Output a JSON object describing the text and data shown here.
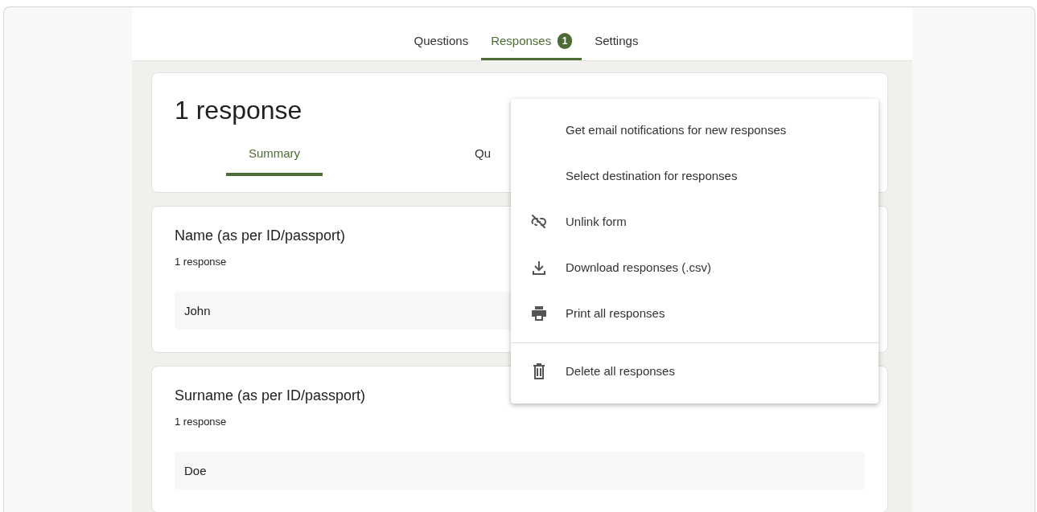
{
  "tabs": [
    {
      "label": "Questions",
      "selected": false
    },
    {
      "label": "Responses",
      "selected": true,
      "badge": "1"
    },
    {
      "label": "Settings",
      "selected": false
    }
  ],
  "summary_card": {
    "title": "1 response",
    "tabs": [
      {
        "label": "Summary",
        "selected": true
      },
      {
        "label": "Qu",
        "selected": false
      }
    ]
  },
  "questions": [
    {
      "title": "Name (as per ID/passport)",
      "count": "1 response",
      "answers": [
        "John"
      ]
    },
    {
      "title": "Surname (as per ID/passport)",
      "count": "1 response",
      "answers": [
        "Doe"
      ]
    }
  ],
  "menu": {
    "groups": [
      [
        {
          "kind": "plain",
          "label": "Get email notifications for new responses"
        },
        {
          "kind": "plain",
          "label": "Select destination for responses"
        },
        {
          "kind": "unlink",
          "label": "Unlink form"
        },
        {
          "kind": "download",
          "label": "Download responses (.csv)"
        },
        {
          "kind": "print",
          "label": "Print all responses"
        }
      ],
      [
        {
          "kind": "delete",
          "label": "Delete all responses"
        }
      ]
    ]
  }
}
